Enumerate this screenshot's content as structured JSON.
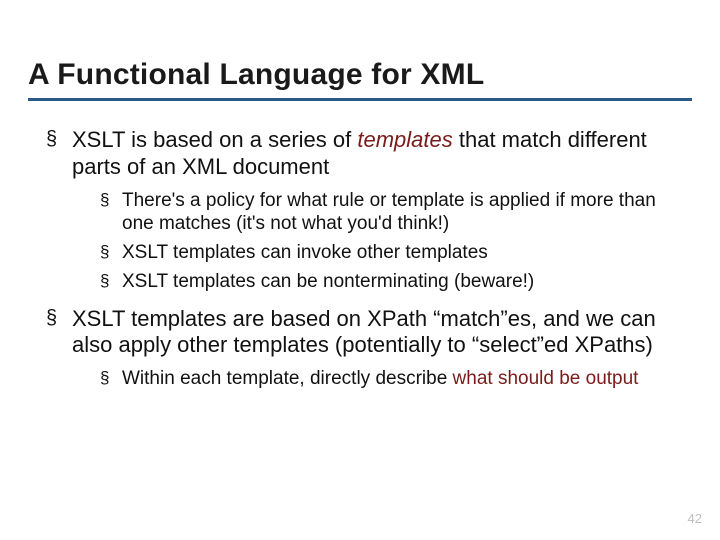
{
  "title": "A Functional Language for XML",
  "bullets": {
    "b1_pre": "XSLT is based on a series of ",
    "b1_kw": "templates",
    "b1_post": "  that match different parts of an XML document",
    "b1_s1": "There's a policy for what rule or template is applied if more than one matches (it's not what you'd think!)",
    "b1_s2": "XSLT templates can invoke other templates",
    "b1_s3": "XSLT templates can be nonterminating (beware!)",
    "b2": "XSLT templates are based on XPath “match”es, and we can also apply other templates (potentially to “select”ed XPaths)",
    "b2_s1_pre": "Within each template, directly describe ",
    "b2_s1_kw": "what should be output"
  },
  "page_number": "42"
}
